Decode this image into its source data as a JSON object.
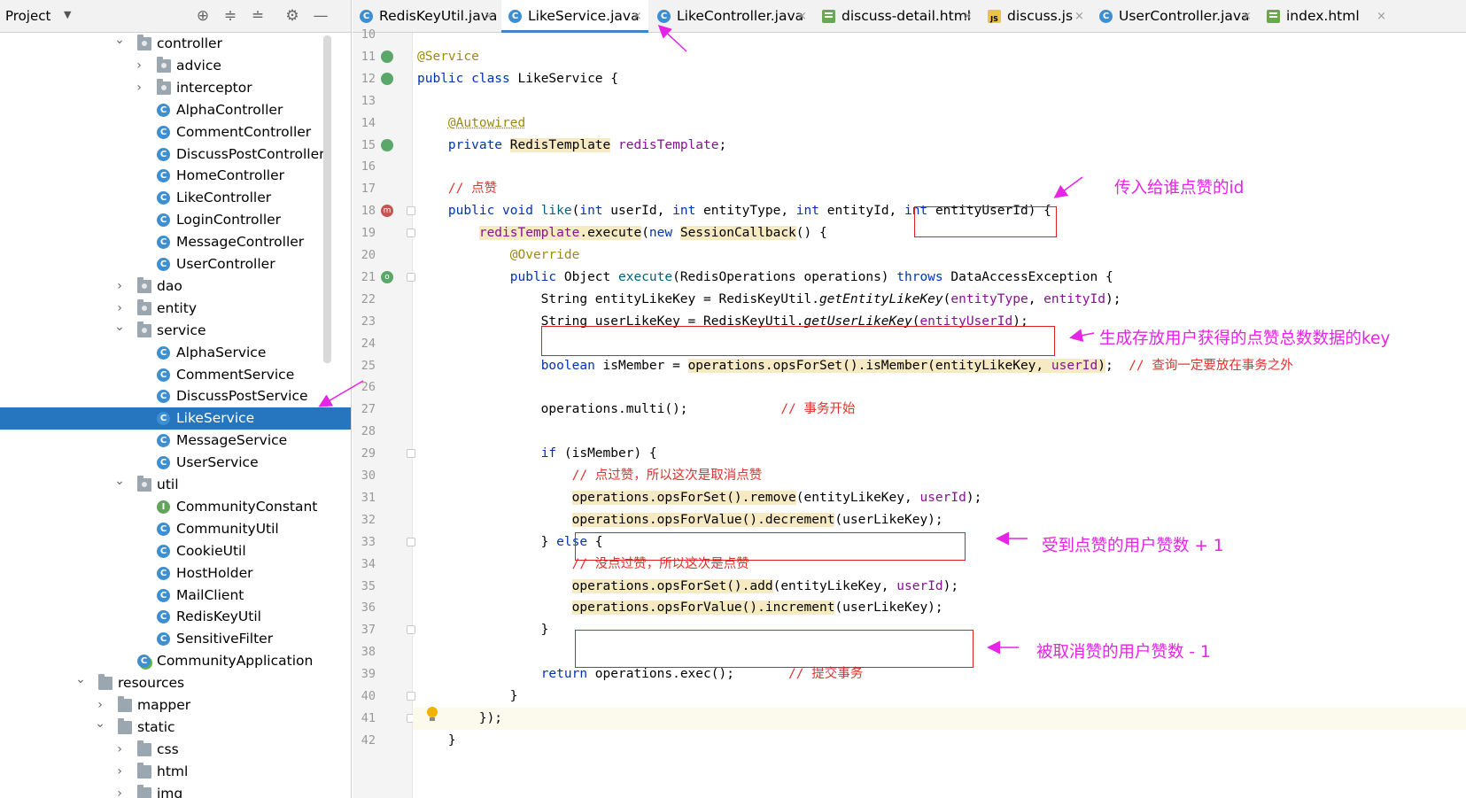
{
  "project_panel": {
    "title": "Project",
    "dropdown_icon": "chevron-down-icon",
    "header_icons": [
      "target-icon",
      "expand-all-icon",
      "collapse-all-icon",
      "gear-icon",
      "minimize-icon"
    ],
    "tree": [
      {
        "label": "controller",
        "kind": "package",
        "expanded": true,
        "depth": 0
      },
      {
        "label": "advice",
        "kind": "package",
        "expanded": false,
        "depth": 1
      },
      {
        "label": "interceptor",
        "kind": "package",
        "expanded": false,
        "depth": 1
      },
      {
        "label": "AlphaController",
        "kind": "class",
        "depth": 1
      },
      {
        "label": "CommentController",
        "kind": "class",
        "depth": 1
      },
      {
        "label": "DiscussPostController",
        "kind": "class",
        "depth": 1
      },
      {
        "label": "HomeController",
        "kind": "class",
        "depth": 1
      },
      {
        "label": "LikeController",
        "kind": "class",
        "depth": 1
      },
      {
        "label": "LoginController",
        "kind": "class",
        "depth": 1
      },
      {
        "label": "MessageController",
        "kind": "class",
        "depth": 1
      },
      {
        "label": "UserController",
        "kind": "class",
        "depth": 1
      },
      {
        "label": "dao",
        "kind": "package",
        "expanded": false,
        "depth": 0
      },
      {
        "label": "entity",
        "kind": "package",
        "expanded": false,
        "depth": 0
      },
      {
        "label": "service",
        "kind": "package",
        "expanded": true,
        "depth": 0
      },
      {
        "label": "AlphaService",
        "kind": "class",
        "depth": 1
      },
      {
        "label": "CommentService",
        "kind": "class",
        "depth": 1
      },
      {
        "label": "DiscussPostService",
        "kind": "class",
        "depth": 1
      },
      {
        "label": "LikeService",
        "kind": "class",
        "depth": 1,
        "selected": true
      },
      {
        "label": "MessageService",
        "kind": "class",
        "depth": 1
      },
      {
        "label": "UserService",
        "kind": "class",
        "depth": 1
      },
      {
        "label": "util",
        "kind": "package",
        "expanded": true,
        "depth": 0
      },
      {
        "label": "CommunityConstant",
        "kind": "interface",
        "depth": 1
      },
      {
        "label": "CommunityUtil",
        "kind": "class",
        "depth": 1
      },
      {
        "label": "CookieUtil",
        "kind": "class",
        "depth": 1
      },
      {
        "label": "HostHolder",
        "kind": "class",
        "depth": 1
      },
      {
        "label": "MailClient",
        "kind": "class",
        "depth": 1
      },
      {
        "label": "RedisKeyUtil",
        "kind": "class",
        "depth": 1
      },
      {
        "label": "SensitiveFilter",
        "kind": "class",
        "depth": 1
      },
      {
        "label": "CommunityApplication",
        "kind": "app",
        "depth": 0
      },
      {
        "label": "resources",
        "kind": "folder",
        "expanded": true,
        "depth": -2
      },
      {
        "label": "mapper",
        "kind": "folder",
        "expanded": false,
        "depth": -1
      },
      {
        "label": "static",
        "kind": "folder",
        "expanded": true,
        "depth": -1
      },
      {
        "label": "css",
        "kind": "folder",
        "expanded": false,
        "depth": 0
      },
      {
        "label": "html",
        "kind": "folder",
        "expanded": false,
        "depth": 0
      },
      {
        "label": "img",
        "kind": "folder",
        "expanded": false,
        "depth": 0
      }
    ]
  },
  "tabs": [
    {
      "label": "RedisKeyUtil.java",
      "type": "java",
      "active": false
    },
    {
      "label": "LikeService.java",
      "type": "java",
      "active": true
    },
    {
      "label": "LikeController.java",
      "type": "java",
      "active": false
    },
    {
      "label": "discuss-detail.html",
      "type": "html",
      "active": false
    },
    {
      "label": "discuss.js",
      "type": "js",
      "active": false
    },
    {
      "label": "UserController.java",
      "type": "java",
      "active": false
    },
    {
      "label": "index.html",
      "type": "html",
      "active": false
    }
  ],
  "tab_close_glyph": "×",
  "editor": {
    "current_line": 41,
    "lines": [
      {
        "n": 10,
        "code": []
      },
      {
        "n": 11,
        "code": [
          [
            "ann",
            "@Service"
          ]
        ]
      },
      {
        "n": 12,
        "code": [
          [
            "kw",
            "public class "
          ],
          [
            "",
            "LikeService {"
          ]
        ]
      },
      {
        "n": 13,
        "code": []
      },
      {
        "n": 14,
        "code": [
          [
            "",
            "    "
          ],
          [
            "ann squiggle",
            "@Autowired"
          ]
        ]
      },
      {
        "n": 15,
        "code": [
          [
            "",
            "    "
          ],
          [
            "kw",
            "private "
          ],
          [
            "hl",
            "RedisTemplate"
          ],
          [
            "",
            " "
          ],
          [
            "fld",
            "redisTemplate"
          ],
          [
            "",
            ";"
          ]
        ]
      },
      {
        "n": 16,
        "code": []
      },
      {
        "n": 17,
        "code": [
          [
            "",
            "    "
          ],
          [
            "cmt",
            "// 点赞"
          ]
        ]
      },
      {
        "n": 18,
        "code": [
          [
            "",
            "    "
          ],
          [
            "kw",
            "public void "
          ],
          [
            "mth",
            "like"
          ],
          [
            "",
            "("
          ],
          [
            "kw",
            "int "
          ],
          [
            "",
            "userId, "
          ],
          [
            "kw",
            "int "
          ],
          [
            "",
            "entityType, "
          ],
          [
            "kw",
            "int "
          ],
          [
            "",
            "entityId, "
          ],
          [
            "kw",
            "int "
          ],
          [
            "",
            "entityUserId) {"
          ]
        ]
      },
      {
        "n": 19,
        "code": [
          [
            "",
            "        "
          ],
          [
            "hl fld",
            "redisTemplate"
          ],
          [
            "hl",
            ".execute"
          ],
          [
            "",
            "("
          ],
          [
            "kw",
            "new "
          ],
          [
            "hl",
            "SessionCallback"
          ],
          [
            "",
            "() {"
          ]
        ]
      },
      {
        "n": 20,
        "code": [
          [
            "",
            "            "
          ],
          [
            "ann",
            "@Override"
          ]
        ]
      },
      {
        "n": 21,
        "code": [
          [
            "",
            "            "
          ],
          [
            "kw",
            "public "
          ],
          [
            "",
            "Object "
          ],
          [
            "mth",
            "execute"
          ],
          [
            "",
            "(RedisOperations operations) "
          ],
          [
            "kw",
            "throws "
          ],
          [
            "",
            "DataAccessException {"
          ]
        ]
      },
      {
        "n": 22,
        "code": [
          [
            "",
            "                String entityLikeKey = RedisKeyUtil."
          ],
          [
            "it",
            "getEntityLikeKey"
          ],
          [
            "",
            "("
          ],
          [
            "fld",
            "entityType"
          ],
          [
            "",
            ", "
          ],
          [
            "fld",
            "entityId"
          ],
          [
            "",
            ");"
          ]
        ]
      },
      {
        "n": 23,
        "code": [
          [
            "",
            "                String userLikeKey = RedisKeyUtil."
          ],
          [
            "it",
            "getUserLikeKey"
          ],
          [
            "",
            "("
          ],
          [
            "fld",
            "entityUserId"
          ],
          [
            "",
            ");"
          ]
        ]
      },
      {
        "n": 24,
        "code": []
      },
      {
        "n": 25,
        "code": [
          [
            "",
            "                "
          ],
          [
            "kw",
            "boolean "
          ],
          [
            "",
            "isMember = "
          ],
          [
            "hl",
            "operations.opsForSet().isMember(entityLikeKey, "
          ],
          [
            "hl fld",
            "userId"
          ],
          [
            "hl",
            ")"
          ],
          [
            "",
            ";  "
          ],
          [
            "cmt",
            "// 查询一定要放在事务之外"
          ]
        ]
      },
      {
        "n": 26,
        "code": []
      },
      {
        "n": 27,
        "code": [
          [
            "",
            "                operations.multi();            "
          ],
          [
            "cmt",
            "// 事务开始"
          ]
        ]
      },
      {
        "n": 28,
        "code": []
      },
      {
        "n": 29,
        "code": [
          [
            "",
            "                "
          ],
          [
            "kw",
            "if "
          ],
          [
            "",
            "(isMember) {"
          ]
        ]
      },
      {
        "n": 30,
        "code": [
          [
            "",
            "                    "
          ],
          [
            "cmt",
            "// 点过赞，所以这次是取消点赞"
          ]
        ]
      },
      {
        "n": 31,
        "code": [
          [
            "",
            "                    "
          ],
          [
            "hl",
            "operations.opsForSet().remove"
          ],
          [
            "",
            "(entityLikeKey, "
          ],
          [
            "fld",
            "userId"
          ],
          [
            "",
            ");"
          ]
        ]
      },
      {
        "n": 32,
        "code": [
          [
            "",
            "                    "
          ],
          [
            "hl",
            "operations.opsForValue().decrement"
          ],
          [
            "",
            "(userLikeKey);"
          ]
        ]
      },
      {
        "n": 33,
        "code": [
          [
            "",
            "                } "
          ],
          [
            "kw",
            "else "
          ],
          [
            "",
            "{"
          ]
        ]
      },
      {
        "n": 34,
        "code": [
          [
            "",
            "                    "
          ],
          [
            "cmt",
            "// 没点过赞，所以这次是点赞"
          ]
        ]
      },
      {
        "n": 35,
        "code": [
          [
            "",
            "                    "
          ],
          [
            "hl",
            "operations.opsForSet().add"
          ],
          [
            "",
            "(entityLikeKey, "
          ],
          [
            "fld",
            "userId"
          ],
          [
            "",
            ");"
          ]
        ]
      },
      {
        "n": 36,
        "code": [
          [
            "",
            "                    "
          ],
          [
            "hl",
            "operations.opsForValue().increment"
          ],
          [
            "",
            "(userLikeKey);"
          ]
        ]
      },
      {
        "n": 37,
        "code": [
          [
            "",
            "                }"
          ]
        ]
      },
      {
        "n": 38,
        "code": []
      },
      {
        "n": 39,
        "code": [
          [
            "",
            "                "
          ],
          [
            "kw",
            "return "
          ],
          [
            "",
            "operations.exec();       "
          ],
          [
            "cmt",
            "// 提交事务"
          ]
        ]
      },
      {
        "n": 40,
        "code": [
          [
            "",
            "            }"
          ]
        ]
      },
      {
        "n": 41,
        "code": [
          [
            "",
            "        });"
          ]
        ]
      },
      {
        "n": 42,
        "code": [
          [
            "",
            "    }"
          ]
        ]
      }
    ]
  },
  "annotations": {
    "note_entity_user_id": "传入给谁点赞的id",
    "note_user_like_key": "生成存放用户获得的点赞总数数据的key",
    "note_decrement": "受到点赞的用户赞数 + 1",
    "note_increment": "被取消赞的用户赞数 - 1",
    "color_text": "#e624e6",
    "color_box": "#e02020"
  },
  "colors": {
    "keyword": "#0033b3",
    "annotation": "#9e880d",
    "comment": "#e0312c",
    "field": "#871094",
    "selection": "#2675bf",
    "tab_underline": "#4083c9"
  }
}
